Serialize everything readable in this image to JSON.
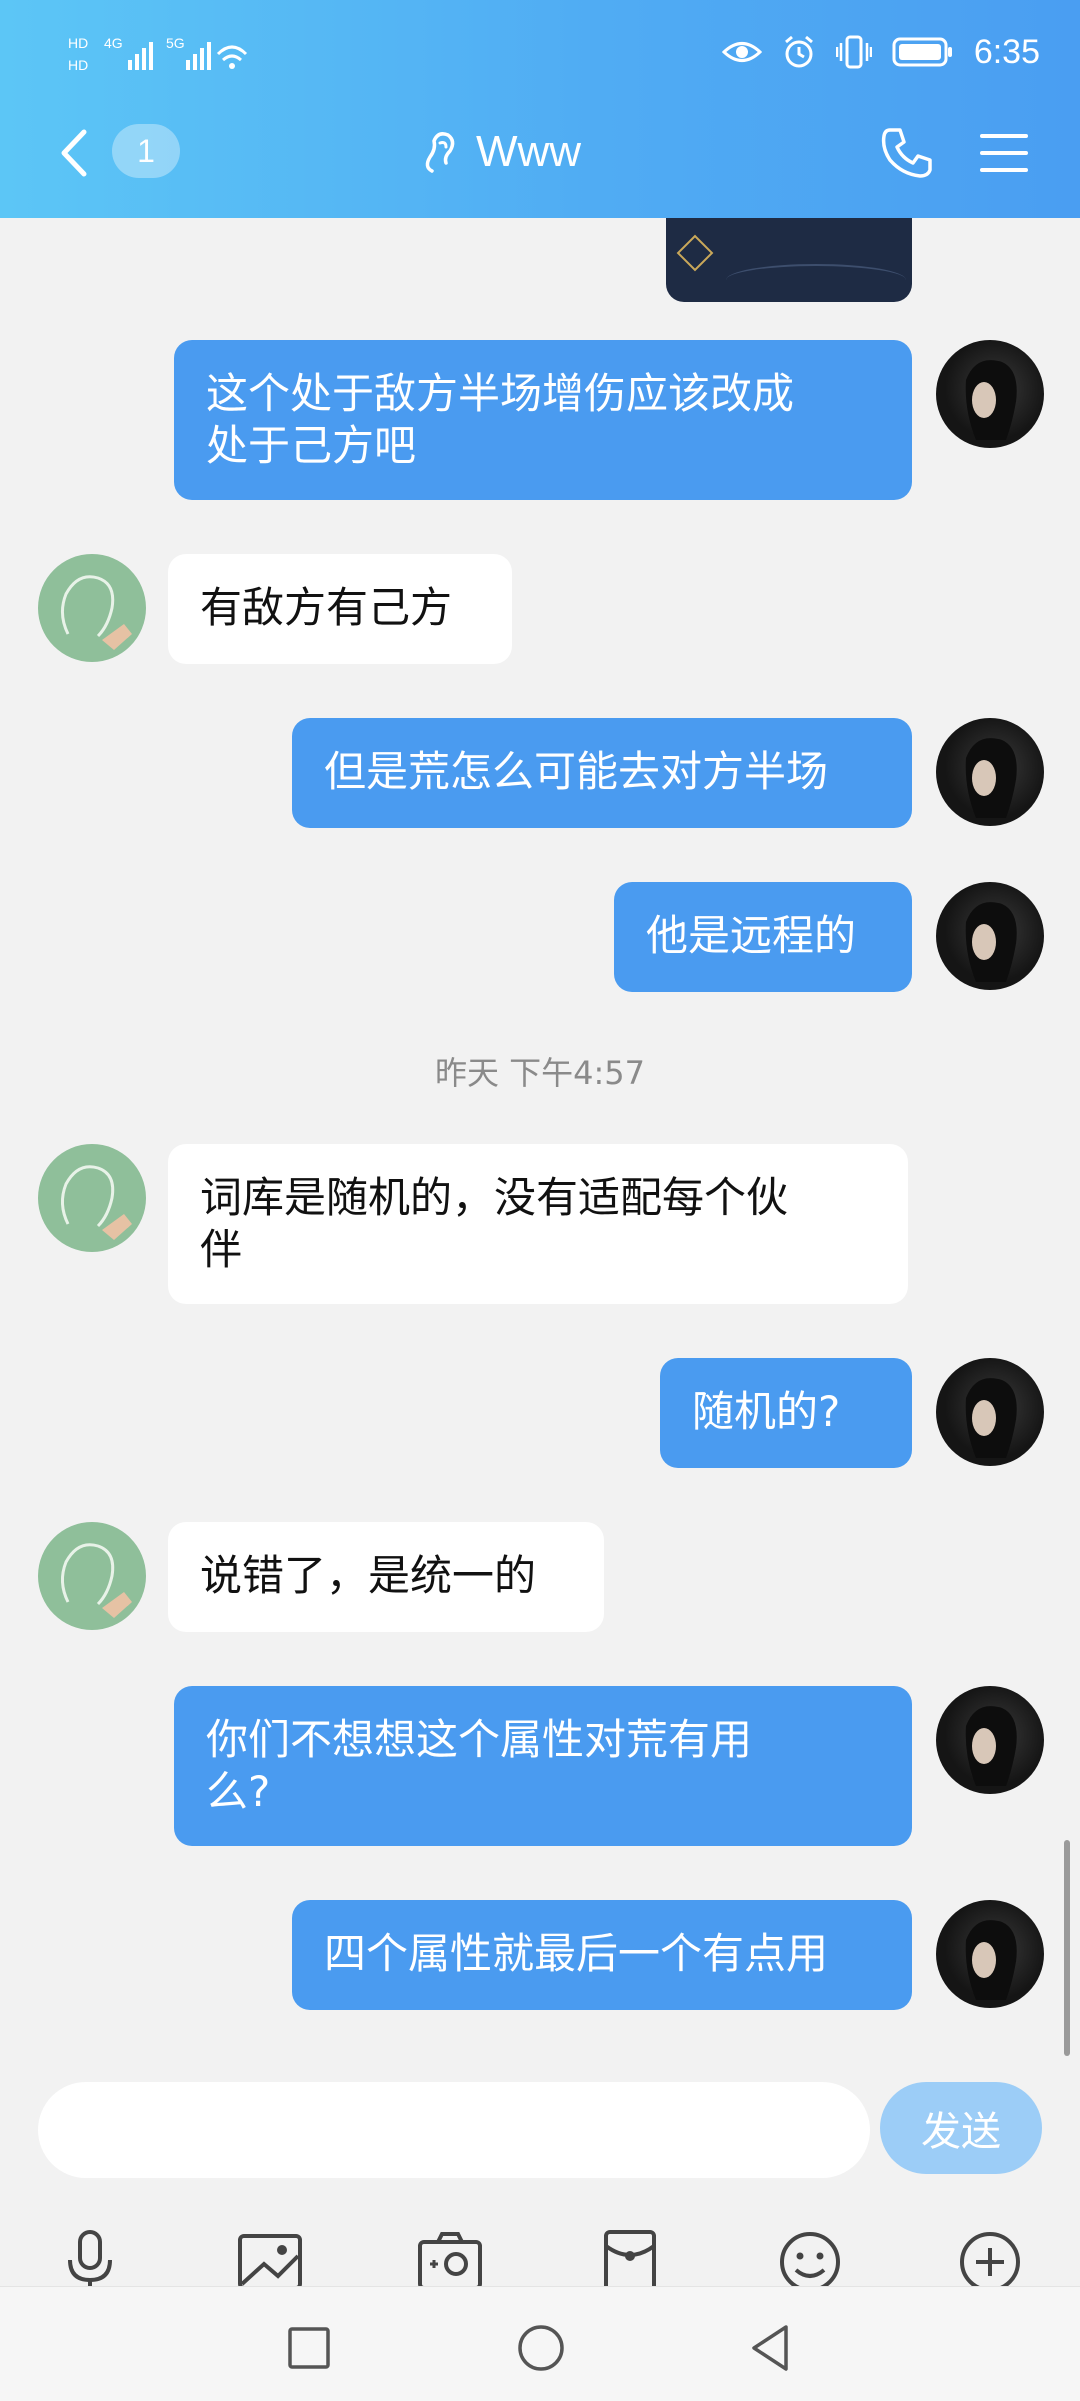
{
  "status_bar": {
    "network_left": [
      "HD",
      "4G",
      "5G"
    ],
    "time": "6:35"
  },
  "header": {
    "back_badge": "1",
    "title": "Www"
  },
  "chat": {
    "timestamp": "昨天 下午4:57",
    "messages": [
      {
        "sender": "me",
        "text": "这个处于敌方半场增伤应该改成\n处于己方吧"
      },
      {
        "sender": "other",
        "text": "有敌方有己方"
      },
      {
        "sender": "me",
        "text": "但是荒怎么可能去对方半场"
      },
      {
        "sender": "me",
        "text": "他是远程的"
      },
      {
        "sender": "other",
        "text": "词库是随机的，没有适配每个伙\n伴"
      },
      {
        "sender": "me",
        "text": "随机的?"
      },
      {
        "sender": "other",
        "text": "说错了，是统一的"
      },
      {
        "sender": "me",
        "text": "你们不想想这个属性对荒有用\n么?"
      },
      {
        "sender": "me",
        "text": "四个属性就最后一个有点用"
      }
    ]
  },
  "input": {
    "value": "",
    "placeholder": "",
    "send_label": "发送"
  },
  "toolbar": {
    "icons": [
      "microphone-icon",
      "image-icon",
      "camera-icon",
      "red-packet-icon",
      "emoji-icon",
      "plus-icon"
    ]
  },
  "colors": {
    "my_bubble": "#4a9bf0",
    "other_bubble": "#ffffff",
    "header_gradient_start": "#5cc6f6",
    "header_gradient_end": "#4a9ef2",
    "send_button": "#9ccdf7"
  }
}
